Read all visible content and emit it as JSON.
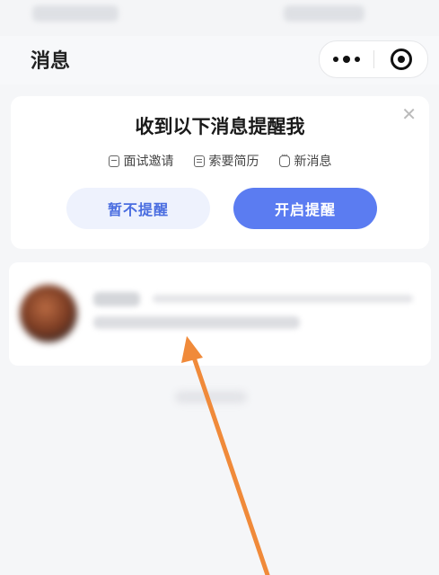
{
  "nav": {
    "title": "消息"
  },
  "notification_prompt": {
    "title": "收到以下消息提醒我",
    "features": [
      {
        "icon": "briefcase-icon",
        "label": "面试邀请"
      },
      {
        "icon": "document-icon",
        "label": "索要简历"
      },
      {
        "icon": "chat-bubble-icon",
        "label": "新消息"
      }
    ],
    "later_label": "暂不提醒",
    "enable_label": "开启提醒",
    "colors": {
      "primary": "#5b7cf1",
      "secondary_bg": "#eef2fd",
      "secondary_text": "#4a6de0"
    }
  }
}
